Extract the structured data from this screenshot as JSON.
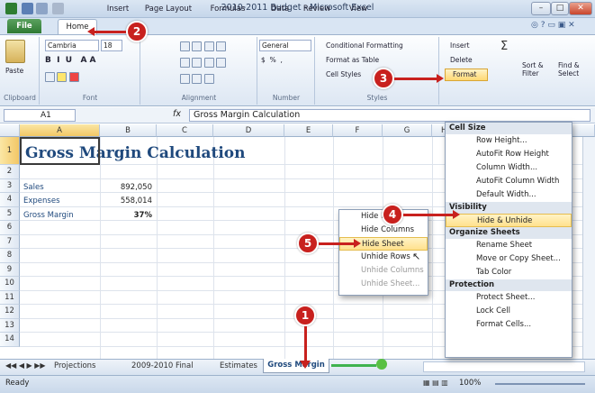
{
  "window": {
    "title": "2010-2011 Budget - Microsoft Excel",
    "min": "–",
    "max": "□",
    "close": "✕"
  },
  "tabs": {
    "file": "File",
    "home": "Home",
    "insert": "Insert",
    "page_layout": "Page Layout",
    "formulas": "Formulas",
    "data": "Data",
    "review": "Review",
    "view": "View"
  },
  "ribbon": {
    "paste": "Paste",
    "clipboard": "Clipboard",
    "font_name": "Cambria",
    "font_size": "18",
    "font": "Font",
    "alignment": "Alignment",
    "number_format": "General",
    "number": "Number",
    "conditional_formatting": "Conditional Formatting",
    "format_as_table": "Format as Table",
    "cell_styles": "Cell Styles",
    "styles": "Styles",
    "insert": "Insert",
    "delete": "Delete",
    "format": "Format",
    "sort_filter": "Sort & Filter",
    "find_select": "Find & Select",
    "pct_btn": "%",
    "dollar": "$",
    "comma": ","
  },
  "formula_bar": {
    "name_box": "A1",
    "fx": "fx",
    "content": "Gross Margin Calculation"
  },
  "columns": [
    "A",
    "B",
    "C",
    "D",
    "E",
    "F",
    "G",
    "H"
  ],
  "rows": [
    "1",
    "2",
    "3",
    "4",
    "5",
    "6",
    "7",
    "8",
    "9",
    "10",
    "11",
    "12",
    "13",
    "14"
  ],
  "cells": {
    "title": "Gross Margin Calculation",
    "r3a": "Sales",
    "r3b": "892,050",
    "r4a": "Expenses",
    "r4b": "558,014",
    "r5a": "Gross Margin",
    "r5b": "37%"
  },
  "format_menu": {
    "cell_size": "Cell Size",
    "row_height": "Row Height...",
    "autofit_row": "AutoFit Row Height",
    "col_width": "Column Width...",
    "autofit_col": "AutoFit Column Width",
    "default_width": "Default Width...",
    "visibility": "Visibility",
    "hide_unhide": "Hide & Unhide",
    "organize": "Organize Sheets",
    "rename": "Rename Sheet",
    "move_copy": "Move or Copy Sheet...",
    "tab_color": "Tab Color",
    "protection": "Protection",
    "protect": "Protect Sheet...",
    "lock": "Lock Cell",
    "format_cells": "Format Cells..."
  },
  "submenu": {
    "hide_rows": "Hide Rows",
    "hide_columns": "Hide Columns",
    "hide_sheet": "Hide Sheet",
    "unhide_rows": "Unhide Rows",
    "unhide_columns": "Unhide Columns",
    "unhide_sheet": "Unhide Sheet..."
  },
  "sheet_tabs": [
    "Projections",
    "2009-2010 Final",
    "Estimates",
    "Gross Margin"
  ],
  "status": {
    "ready": "Ready",
    "zoom": "100%"
  },
  "callouts": [
    "1",
    "2",
    "3",
    "4",
    "5"
  ],
  "colors": {
    "callout": "#c8211e",
    "title_text": "#1f497d",
    "file_tab": "#2f7a33"
  }
}
